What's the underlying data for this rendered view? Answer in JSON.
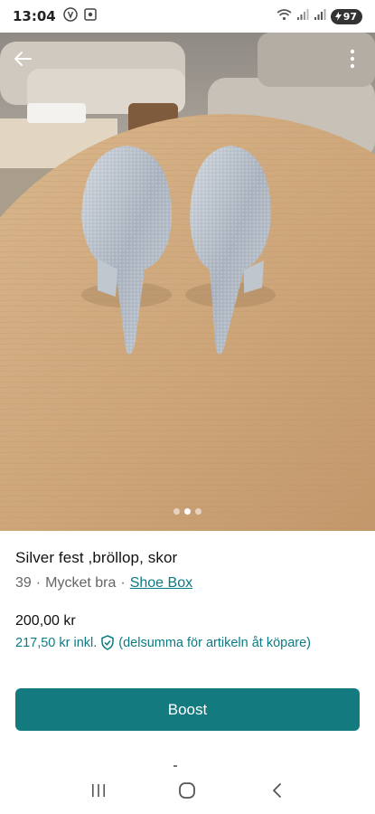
{
  "status_bar": {
    "time": "13:04",
    "battery": "97"
  },
  "listing": {
    "title": "Silver fest ,bröllop, skor",
    "size": "39",
    "condition": "Mycket bra",
    "brand": "Shoe Box",
    "price": "200,00 kr",
    "price_incl_amount": "217,50 kr",
    "price_incl_label": "inkl.",
    "price_incl_note": "(delsumma för artikeln åt köpare)"
  },
  "gallery": {
    "count": 3,
    "active_index": 1
  },
  "actions": {
    "boost_label": "Boost"
  },
  "icons": {
    "back": "arrow-left-icon",
    "more": "more-vertical-icon",
    "shield": "shield-check-icon",
    "nav_recents": "recents-icon",
    "nav_home": "home-icon",
    "nav_back": "chevron-left-icon"
  },
  "colors": {
    "accent": "#137b80",
    "link": "#0c7a82"
  },
  "separator": "·"
}
